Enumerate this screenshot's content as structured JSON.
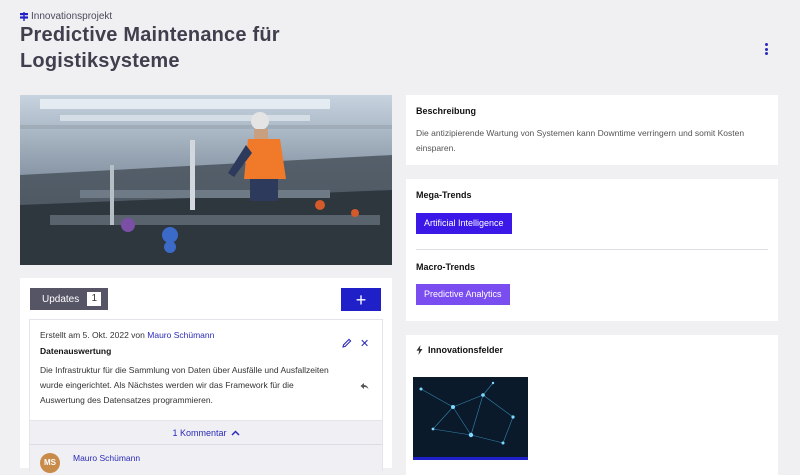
{
  "breadcrumb": {
    "label": "Innovationsprojekt",
    "icon": "signpost-icon"
  },
  "title": "Predictive Maintenance für Logistiksysteme",
  "updates": {
    "tab_label": "Updates",
    "count": "1",
    "add_label": "+",
    "item": {
      "created_prefix": "Erstellt am 5. Okt. 2022 von",
      "author": "Mauro Schümann",
      "title": "Datenauswertung",
      "body": "Die Infrastruktur für die Sammlung von Daten über Ausfälle und Ausfallzeiten wurde eingerichtet. Als Nächstes werden wir das Framework für die Auswertung des Datensatzes programmieren."
    },
    "comments_label": "1 Kommentar",
    "comment": {
      "initials": "MS",
      "author": "Mauro Schümann"
    }
  },
  "description": {
    "heading": "Beschreibung",
    "text": "Die antizipierende Wartung von Systemen kann Downtime verringern und somit Kosten einsparen."
  },
  "trends": {
    "mega_heading": "Mega-Trends",
    "mega_tag": "Artificial Intelligence",
    "macro_heading": "Macro-Trends",
    "macro_tag": "Predictive Analytics"
  },
  "fields": {
    "heading": "Innovationsfelder",
    "icon": "bolt-icon"
  },
  "colors": {
    "accent": "#2020c8",
    "mega": "#3b17e8",
    "macro": "#7a4df0",
    "tab": "#555566"
  }
}
